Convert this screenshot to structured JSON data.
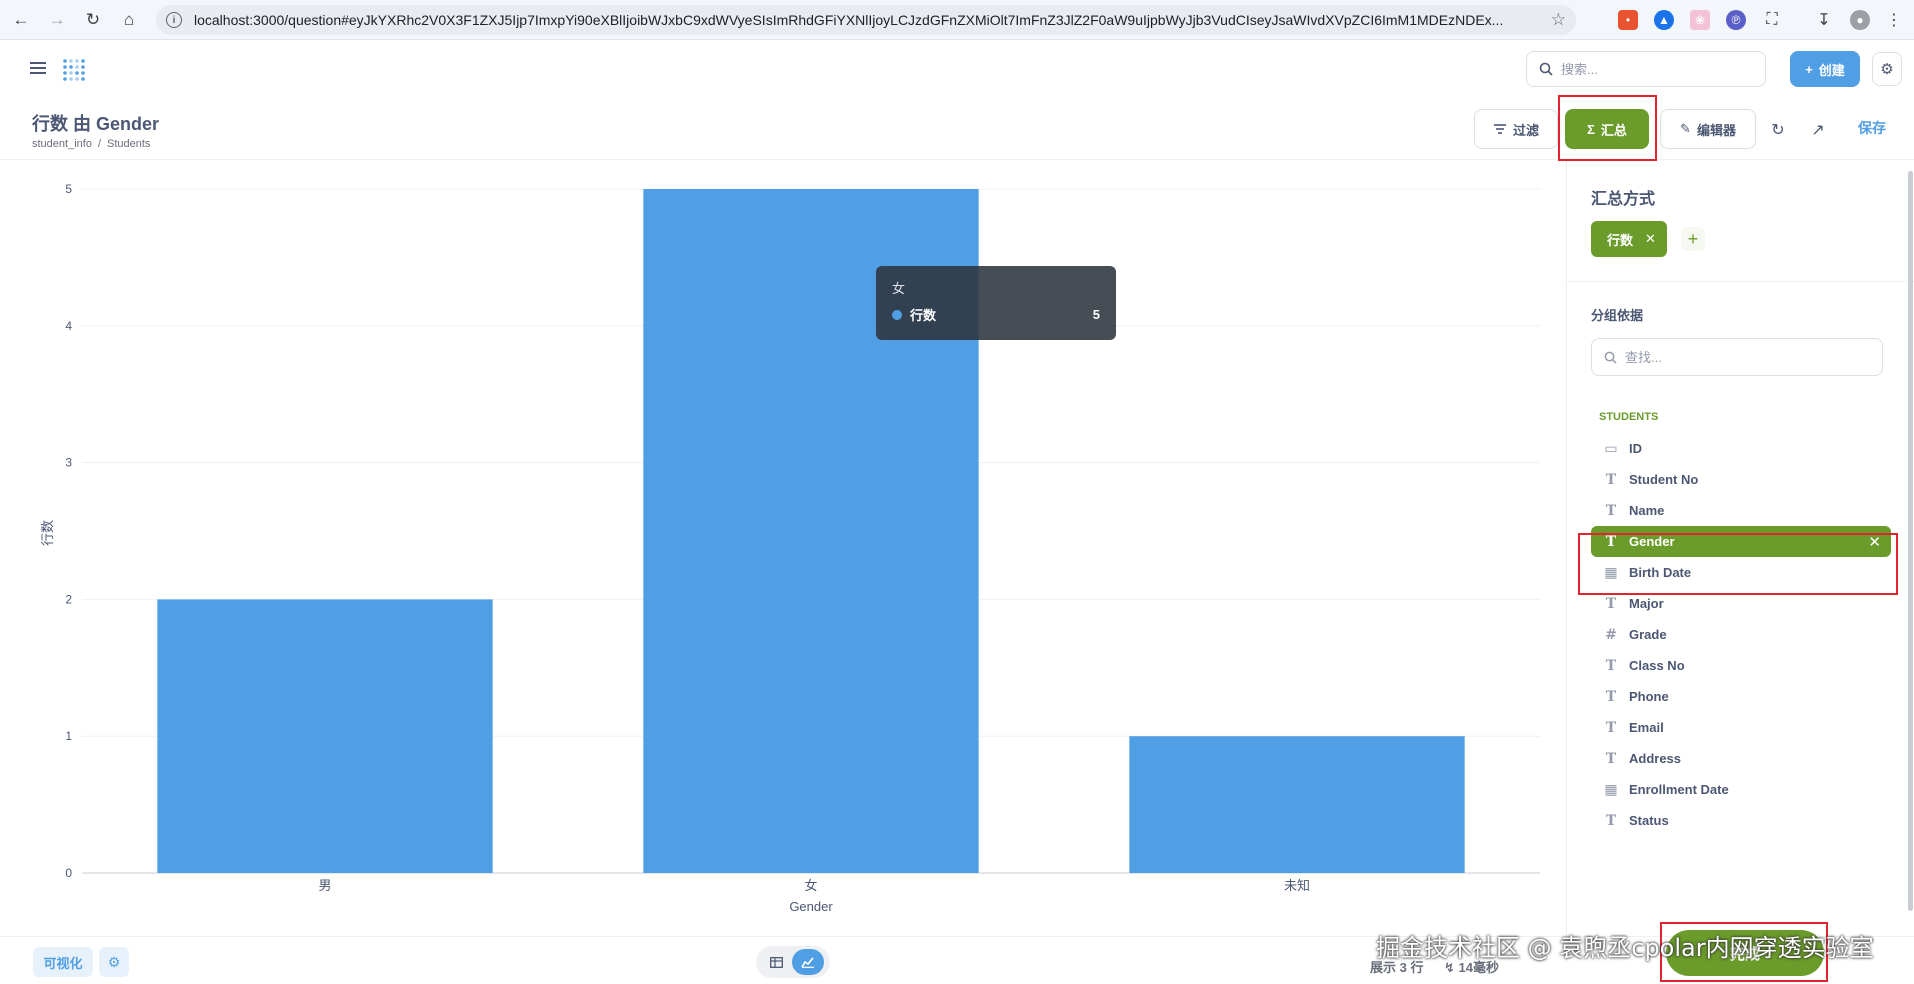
{
  "browser": {
    "url": "localhost:3000/question#eyJkYXRhc2V0X3F1ZXJ5Ijp7ImxpYi90eXBlIjoibWJxbC9xdWVyeSIsImRhdGFiYXNlIjoyLCJzdGFnZXMiOlt7ImFnZ3JlZ2F0aW9uIjpbWyJjb3VudCIseyJsaWIvdXVpZCI6ImM1MDEzNDEx..."
  },
  "header": {
    "search_placeholder": "搜索...",
    "create_label": "创建"
  },
  "question": {
    "title": "行数 由 Gender",
    "breadcrumb": [
      "student_info",
      "/",
      "Students"
    ],
    "filter_label": "过滤",
    "summarize_label": "汇总",
    "editor_label": "编辑器",
    "save_label": "保存"
  },
  "chart_data": {
    "type": "bar",
    "categories": [
      "男",
      "女",
      "未知"
    ],
    "values": [
      2,
      5,
      1
    ],
    "title": "",
    "xlabel": "Gender",
    "ylabel": "行数",
    "ylim": [
      0,
      5
    ],
    "yticks": [
      "0",
      "1",
      "2",
      "3",
      "4",
      "5"
    ],
    "bar_color": "#509ee3",
    "grid": true
  },
  "tooltip": {
    "title": "女",
    "series": "行数",
    "value": "5"
  },
  "sidebar": {
    "title": "汇总方式",
    "metric": "行数",
    "group_label": "分组依据",
    "find_placeholder": "查找...",
    "table_label": "STUDENTS",
    "fields": [
      {
        "name": "ID",
        "icon": "key-icon"
      },
      {
        "name": "Student No",
        "icon": "text-icon"
      },
      {
        "name": "Name",
        "icon": "text-icon"
      },
      {
        "name": "Gender",
        "icon": "text-icon",
        "selected": true
      },
      {
        "name": "Birth Date",
        "icon": "calendar-icon"
      },
      {
        "name": "Major",
        "icon": "text-icon"
      },
      {
        "name": "Grade",
        "icon": "number-icon"
      },
      {
        "name": "Class No",
        "icon": "text-icon"
      },
      {
        "name": "Phone",
        "icon": "text-icon"
      },
      {
        "name": "Email",
        "icon": "text-icon"
      },
      {
        "name": "Address",
        "icon": "text-icon"
      },
      {
        "name": "Enrollment Date",
        "icon": "calendar-icon"
      },
      {
        "name": "Status",
        "icon": "text-icon"
      }
    ],
    "done_label": "完成"
  },
  "footer": {
    "viz_label": "可视化",
    "row_count": "展示 3 行",
    "timing": "14毫秒"
  },
  "watermark": "掘金技术社区 @ 袁煦丞cpolar内网穿透实验室",
  "colors": {
    "brand_blue": "#509ee3",
    "summarize_green": "#6b9b2a",
    "highlight_red": "#e0252f"
  }
}
